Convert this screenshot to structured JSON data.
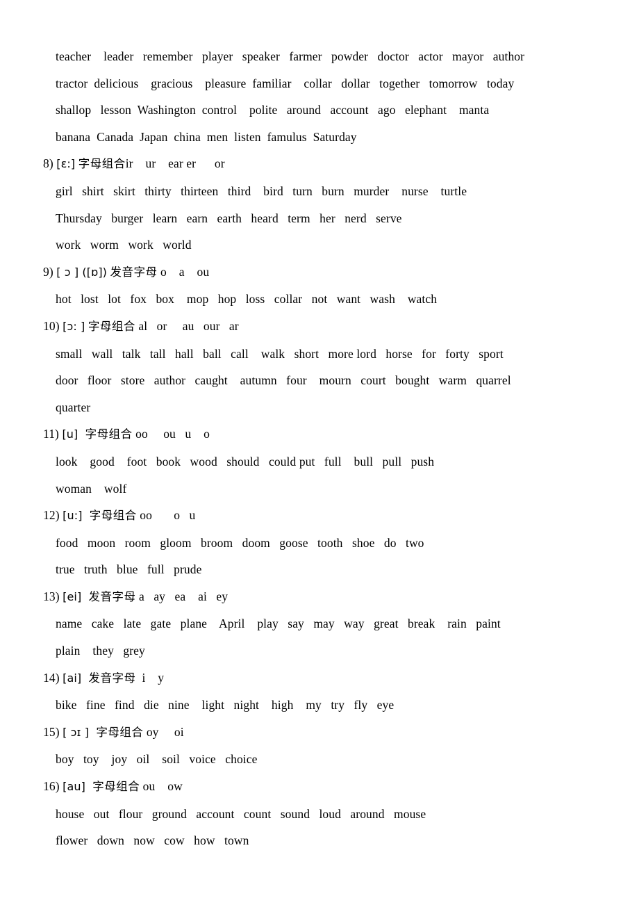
{
  "document": {
    "type": "english-phonetics-word-list",
    "language_note": "Chinese-annotated English pronunciation practice sheet"
  },
  "intro_words": [
    "teacher    leader   remember   player   speaker   farmer   powder   doctor   actor   mayor   author",
    "tractor  delicious    gracious    pleasure  familiar    collar   dollar   together   tomorrow   today",
    "shallop   lesson  Washington  control    polite   around   account   ago   elephant    manta",
    "banana  Canada  Japan  china  men  listen  famulus  Saturday"
  ],
  "sections": [
    {
      "num": "8)",
      "ipa": "[ɛ:]",
      "cn": "字母组合",
      "letters": "ir    ur    ear er      or",
      "words": [
        "girl   shirt   skirt   thirty   thirteen   third    bird   turn   burn   murder    nurse    turtle",
        "Thursday   burger   learn   earn   earth   heard   term   her   nerd   serve",
        "work   worm   work   world"
      ]
    },
    {
      "num": "9)",
      "ipa": "[ ɔ ] ([ɒ])",
      "cn": "发音字母",
      "letters": " o    a    ou",
      "words": [
        "hot   lost   lot   fox   box    mop   hop   loss   collar   not   want   wash    watch"
      ]
    },
    {
      "num": "10)",
      "ipa": "[ɔ: ]",
      "cn": "字母组合",
      "letters": " al   or     au   our   ar",
      "words": [
        "small   wall   talk   tall   hall   ball   call    walk   short   more lord   horse   for   forty   sport",
        "door   floor   store   author   caught    autumn   four    mourn   court   bought   warm   quarrel",
        "quarter"
      ]
    },
    {
      "num": "11)",
      "ipa": "[u]",
      "cn": " 字母组合",
      "letters": " oo     ou   u    o",
      "words": [
        "look    good    foot   book   wood   should   could put   full    bull   pull   push",
        "woman    wolf"
      ]
    },
    {
      "num": "12)",
      "ipa": "[u:]",
      "cn": " 字母组合",
      "letters": " oo       o   u",
      "words": [
        "food   moon   room   gloom   broom   doom   goose   tooth   shoe   do   two",
        "true   truth   blue   full   prude"
      ]
    },
    {
      "num": "13)",
      "ipa": "[ei]",
      "cn": " 发音字母",
      "letters": " a   ay   ea    ai   ey",
      "words": [
        "name   cake   late   gate   plane    April    play   say   may   way   great   break    rain   paint",
        "plain    they   grey"
      ]
    },
    {
      "num": "14)",
      "ipa": "[ai]",
      "cn": " 发音字母",
      "letters": "  i    y",
      "words": [
        "bike   fine   find   die   nine    light   night    high    my   try   fly   eye"
      ]
    },
    {
      "num": "15)",
      "ipa": "[ ɔɪ ]",
      "cn": " 字母组合",
      "letters": " oy     oi",
      "words": [
        "boy   toy    joy   oil    soil   voice   choice"
      ]
    },
    {
      "num": "16)",
      "ipa": "[au]",
      "cn": " 字母组合",
      "letters": " ou    ow",
      "words": [
        "house   out   flour   ground   account   count   sound   loud   around   mouse",
        "flower   down   now   cow   how   town"
      ]
    }
  ]
}
